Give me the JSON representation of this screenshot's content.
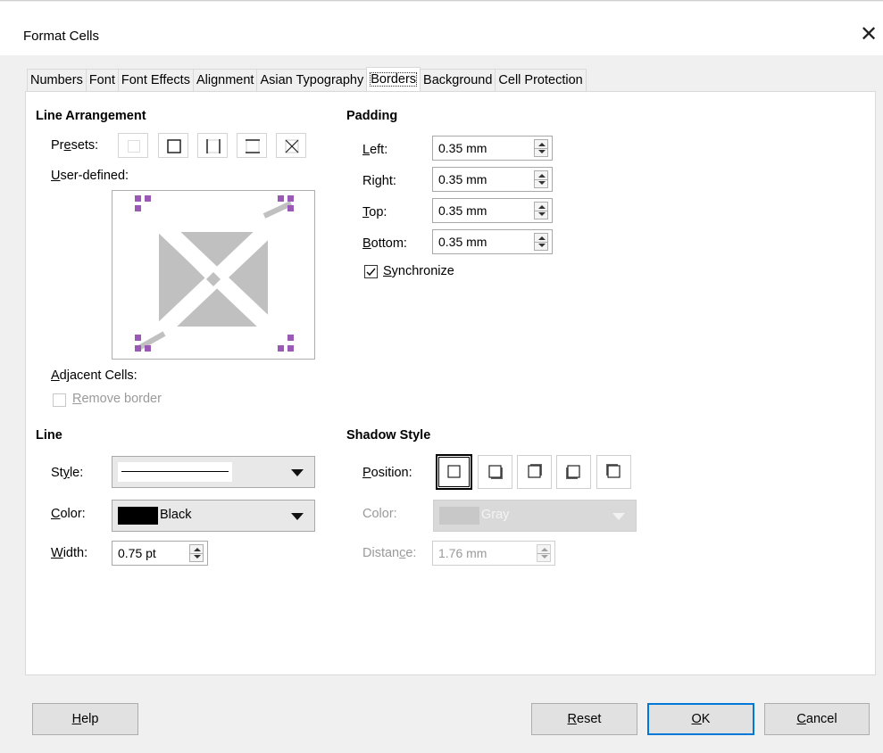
{
  "window": {
    "title": "Format Cells"
  },
  "tabs": [
    {
      "label": "Numbers"
    },
    {
      "label": "Font"
    },
    {
      "label": "Font Effects"
    },
    {
      "label": "Alignment"
    },
    {
      "label": "Asian Typography"
    },
    {
      "label": "Borders",
      "active": true
    },
    {
      "label": "Background"
    },
    {
      "label": "Cell Protection"
    }
  ],
  "line_arrangement": {
    "heading": "Line Arrangement",
    "presets_label_pre": "Pr",
    "presets_label_u": "e",
    "presets_label_post": "sets:",
    "user_defined_label_u": "U",
    "user_defined_label_post": "ser-defined:",
    "adjacent_label_u": "A",
    "adjacent_label_post": "djacent Cells:",
    "remove_border_u": "R",
    "remove_border_post": "emove border"
  },
  "padding": {
    "heading": "Padding",
    "left": {
      "label_u": "L",
      "label_post": "eft:",
      "value": "0.35 mm"
    },
    "right": {
      "label_pre": "Ri",
      "label_u": "g",
      "label_post": "ht:",
      "value": "0.35 mm"
    },
    "top": {
      "label_u": "T",
      "label_post": "op:",
      "value": "0.35 mm"
    },
    "bottom": {
      "label_u": "B",
      "label_post": "ottom:",
      "value": "0.35 mm"
    },
    "synchronize_u": "S",
    "synchronize_post": "ynchronize",
    "synchronize_checked": true
  },
  "line": {
    "heading": "Line",
    "style_label_pre": "St",
    "style_label_u": "y",
    "style_label_post": "le:",
    "color_label_u": "C",
    "color_label_post": "olor:",
    "color_value": "Black",
    "color_swatch": "#000000",
    "width_label_u": "W",
    "width_label_post": "idth:",
    "width_value": "0.75 pt"
  },
  "shadow": {
    "heading": "Shadow Style",
    "position_label_u": "P",
    "position_label_post": "osition:",
    "color_label": "Color:",
    "color_value": "Gray",
    "color_swatch": "#c8c8c8",
    "distance_label_pre": "Distan",
    "distance_label_u": "c",
    "distance_label_post": "e:",
    "distance_value": "1.76 mm"
  },
  "buttons": {
    "help_u": "H",
    "help_post": "elp",
    "reset_u": "R",
    "reset_post": "eset",
    "ok_u": "O",
    "ok_post": "K",
    "cancel_u": "C",
    "cancel_post": "ancel"
  },
  "colors": {
    "handle": "#9b59b6",
    "accent": "#0078d7",
    "border_preview_gray": "#c0c0c0"
  }
}
